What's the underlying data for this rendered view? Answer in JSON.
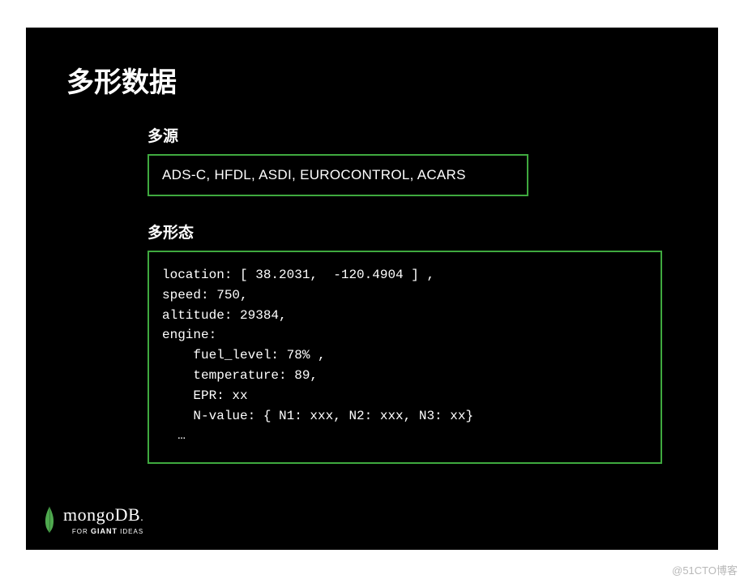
{
  "title": "多形数据",
  "section1": {
    "label": "多源",
    "content": "ADS-C, HFDL, ASDI, EUROCONTROL, ACARS"
  },
  "section2": {
    "label": "多形态",
    "code": {
      "l1": "location: [ 38.2031,  -120.4904 ] ,",
      "l2": "speed: 750,",
      "l3": "altitude: 29384,",
      "l4": "engine:",
      "l5": "    fuel_level: 78% ,",
      "l6": "    temperature: 89,",
      "l7": "    EPR: xx",
      "l8": "    N-value: { N1: xxx, N2: xxx, N3: xx}",
      "l9": "  …"
    }
  },
  "logo": {
    "name": "mongoDB",
    "tagline_prefix": "FOR ",
    "tagline_giant": "GIANT",
    "tagline_suffix": " IDEAS"
  },
  "watermark": "@51CTO博客"
}
